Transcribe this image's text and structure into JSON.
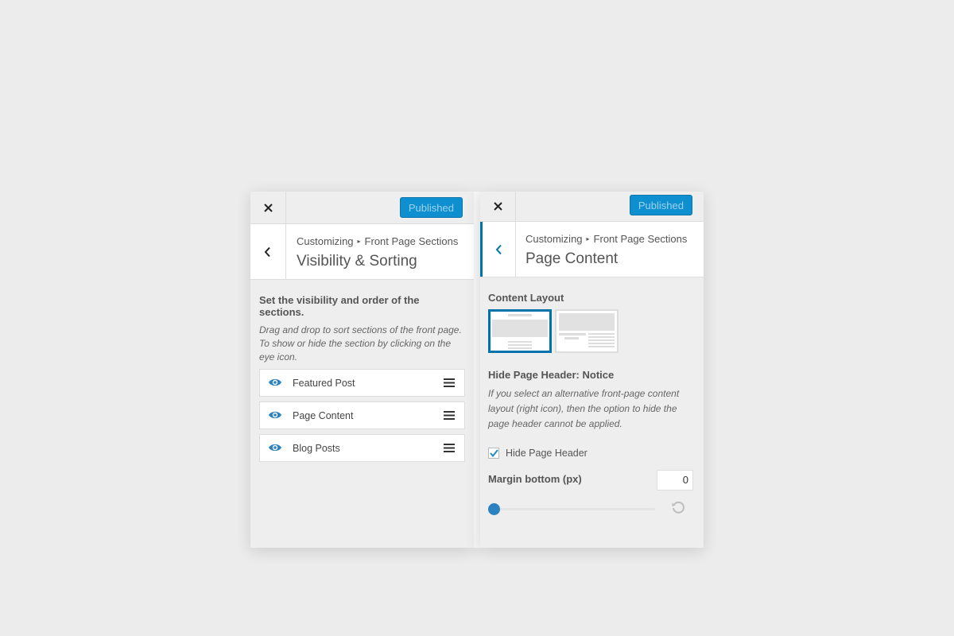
{
  "left_panel": {
    "publish_label": "Published",
    "breadcrumb": {
      "root": "Customizing",
      "section": "Front Page Sections"
    },
    "title": "Visibility & Sorting",
    "description_title": "Set the visibility and order of the sections.",
    "description_text": "Drag and drop to sort sections of the front page. To show or hide the section by clicking on the eye icon.",
    "sections": [
      {
        "label": "Featured Post",
        "eye_icon": "eye-icon",
        "handle_icon": "drag-handle-icon"
      },
      {
        "label": "Page Content",
        "eye_icon": "eye-icon",
        "handle_icon": "drag-handle-icon"
      },
      {
        "label": "Blog Posts",
        "eye_icon": "eye-icon",
        "handle_icon": "drag-handle-icon"
      }
    ]
  },
  "right_panel": {
    "publish_label": "Published",
    "breadcrumb": {
      "root": "Customizing",
      "section": "Front Page Sections"
    },
    "title": "Page Content",
    "content_layout_label": "Content Layout",
    "layout_options": [
      {
        "name": "full-width-layout",
        "selected": true
      },
      {
        "name": "sidebar-layout",
        "selected": false
      }
    ],
    "notice_title": "Hide Page Header: Notice",
    "notice_text": "If you select an alternative front-page content layout (right icon), then the option to hide the page header cannot be applied.",
    "hide_header_label": "Hide Page Header",
    "hide_header_checked": true,
    "margin_label": "Margin bottom (px)",
    "margin_value": "0",
    "slider_value": 0
  },
  "colors": {
    "accent": "#0073aa",
    "publish_button": "#0d8fd0",
    "background": "#ececec"
  }
}
